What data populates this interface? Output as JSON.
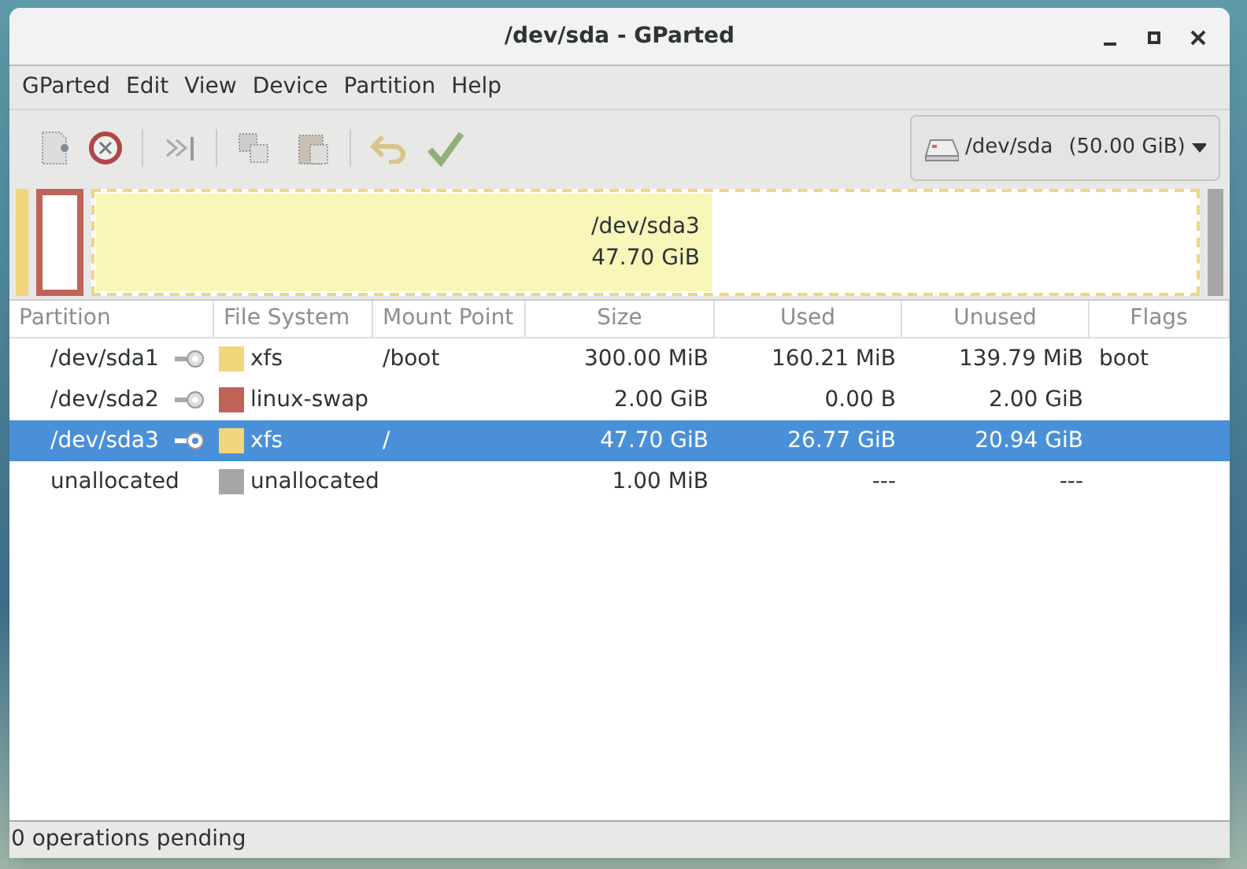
{
  "window": {
    "title": "/dev/sda - GParted"
  },
  "menu": [
    "GParted",
    "Edit",
    "View",
    "Device",
    "Partition",
    "Help"
  ],
  "device_selector": {
    "label": "/dev/sda",
    "size": "(50.00 GiB)"
  },
  "disk_map": {
    "segments": [
      {
        "kind": "partition",
        "color": "#f1d67d"
      },
      {
        "kind": "swap",
        "color": "#c0645a"
      },
      {
        "kind": "partition",
        "color": "#f1d67d",
        "level": 0.56,
        "name": "/dev/sda3",
        "size": "47.70 GiB",
        "selected": true
      },
      {
        "kind": "unallocated",
        "color": "#a6a6a6"
      }
    ]
  },
  "table": {
    "columns": [
      "Partition",
      "File System",
      "Mount Point",
      "Size",
      "Used",
      "Unused",
      "Flags"
    ],
    "rows": [
      {
        "partition": "/dev/sda1",
        "mounted": true,
        "fs": "xfs",
        "color": "#f1d67d",
        "mount": "/boot",
        "size": "300.00 MiB",
        "used": "160.21 MiB",
        "unused": "139.79 MiB",
        "flags": "boot",
        "selected": false
      },
      {
        "partition": "/dev/sda2",
        "mounted": true,
        "fs": "linux-swap",
        "color": "#c0645a",
        "size": "2.00 GiB",
        "used": "0.00 B",
        "unused": "2.00 GiB",
        "selected": false
      },
      {
        "partition": "/dev/sda3",
        "mounted": true,
        "fs": "xfs",
        "color": "#f1d67d",
        "mount": "/",
        "size": "47.70 GiB",
        "used": "26.77 GiB",
        "unused": "20.94 GiB",
        "selected": true
      },
      {
        "partition": "unallocated",
        "mounted": false,
        "fs": "unallocated",
        "color": "#a6a6a6",
        "size": "1.00 MiB",
        "used": "---",
        "unused": "---",
        "selected": false
      }
    ]
  },
  "status_bar": "0 operations pending"
}
